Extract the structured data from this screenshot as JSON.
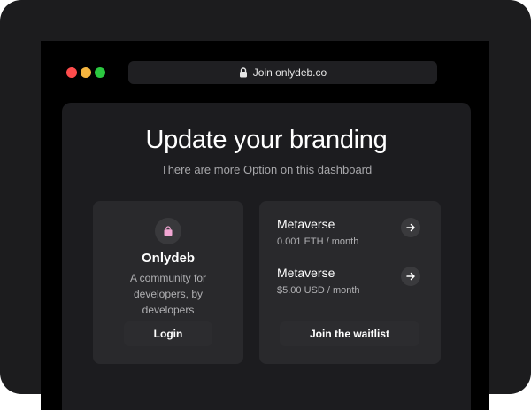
{
  "browser": {
    "url_text": "Join onlydeb.co",
    "lock_icon": "lock-icon"
  },
  "header": {
    "title": "Update your branding",
    "subtitle": "There are more Option on this dashboard"
  },
  "brand_card": {
    "icon": "shopping-bag-icon",
    "name": "Onlydeb",
    "description": "A community for developers, by developers",
    "login_label": "Login"
  },
  "plans_card": {
    "plans": [
      {
        "name": "Metaverse",
        "price": "0.001 ETH / month",
        "icon": "arrow-right-icon"
      },
      {
        "name": "Metaverse",
        "price": "$5.00 USD / month",
        "icon": "arrow-right-icon"
      }
    ],
    "waitlist_label": "Join the waitlist"
  },
  "colors": {
    "window_close": "#ff4d4d",
    "window_minimize": "#f5b53f",
    "window_maximize": "#2bc840",
    "brand_icon": "#f2a7d4"
  }
}
